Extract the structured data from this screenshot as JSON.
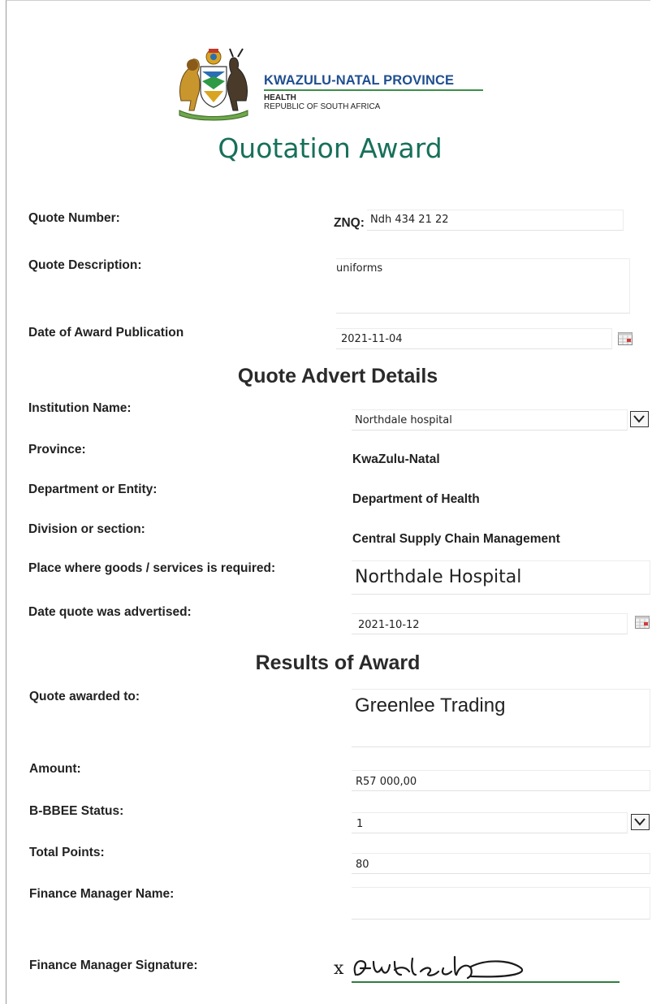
{
  "header": {
    "province_title": "KWAZULU-NATAL PROVINCE",
    "department": "HEALTH",
    "republic": "REPUBLIC OF SOUTH AFRICA",
    "doc_title": "Quotation Award",
    "logo_name": "kzn-coat-of-arms-icon"
  },
  "quote": {
    "number_label": "Quote Number:",
    "number_prefix": "ZNQ:",
    "number_value": "Ndh 434 21 22",
    "description_label": "Quote Description:",
    "description_value": "uniforms",
    "publication_label": "Date of Award Publication",
    "publication_value": "2021-11-04"
  },
  "advert": {
    "section_title": "Quote Advert Details",
    "institution_label": "Institution Name:",
    "institution_value": "Northdale hospital",
    "province_label": "Province:",
    "province_value": "KwaZulu-Natal",
    "department_label": "Department or Entity:",
    "department_value": "Department of Health",
    "division_label": "Division or section:",
    "division_value": "Central Supply Chain Management",
    "place_label": "Place where goods /  services is required:",
    "place_value": "Northdale Hospital",
    "advertised_label": "Date quote was advertised:",
    "advertised_value": "2021-10-12"
  },
  "results": {
    "section_title": "Results of Award",
    "awarded_label": "Quote awarded to:",
    "awarded_value": "Greenlee Trading",
    "amount_label": "Amount:",
    "amount_value": "R57 000,00",
    "bbbee_label": "B-BBEE Status:",
    "bbbee_value": "1",
    "points_label": "Total Points:",
    "points_value": "80",
    "fm_name_label": "Finance Manager Name:",
    "fm_name_value": "",
    "fm_signature_label": "Finance Manager Signature:",
    "signature_mark": "x"
  },
  "colors": {
    "title_green": "#17705a",
    "province_blue": "#1f4f8f",
    "signature_line_green": "#2e7d3e"
  }
}
